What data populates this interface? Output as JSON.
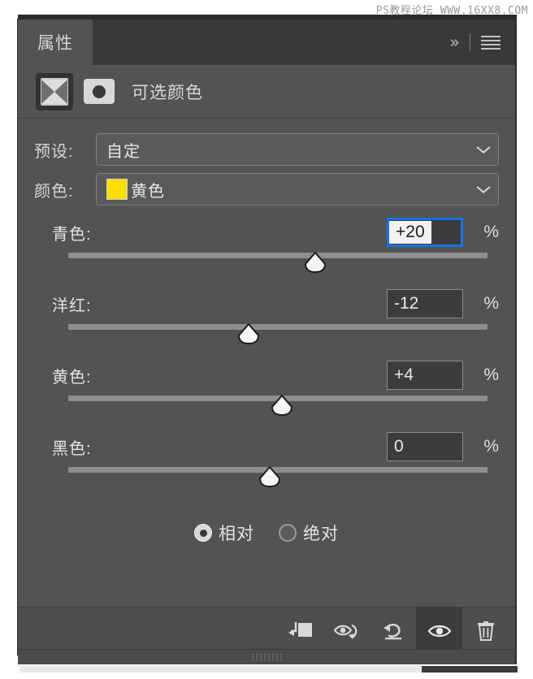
{
  "watermark": "PS教程论坛 WWW.16XX8.COM",
  "panel": {
    "tab_label": "属性",
    "collapse_icon": "chevron-double-right-icon",
    "menu_icon": "hamburger-menu-icon",
    "adjustment": {
      "title": "可选颜色",
      "thumbnail_icon": "selective-color-thumbnail-icon",
      "layer_mask_icon": "layer-mask-icon"
    }
  },
  "preset": {
    "label": "预设:",
    "value": "自定",
    "chevron_icon": "chevron-down-icon"
  },
  "color": {
    "label": "颜色:",
    "value": "黄色",
    "swatch_hex": "#FFDD00",
    "chevron_icon": "chevron-down-icon"
  },
  "sliders": [
    {
      "label": "青色:",
      "value": "+20",
      "unit": "%",
      "focused": true,
      "thumb_pct": 59
    },
    {
      "label": "洋红:",
      "value": "-12",
      "unit": "%",
      "focused": false,
      "thumb_pct": 43
    },
    {
      "label": "黄色:",
      "value": "+4",
      "unit": "%",
      "focused": false,
      "thumb_pct": 51
    },
    {
      "label": "黑色:",
      "value": "0",
      "unit": "%",
      "focused": false,
      "thumb_pct": 48
    }
  ],
  "method": {
    "relative": {
      "label": "相对",
      "selected": true
    },
    "absolute": {
      "label": "绝对",
      "selected": false
    }
  },
  "footer": {
    "clip_to_layer_icon": "clip-to-layer-icon",
    "view_previous_icon": "view-previous-state-icon",
    "reset_icon": "reset-icon",
    "visibility_icon": "toggle-visibility-eye-icon",
    "delete_icon": "trash-delete-icon"
  },
  "accent": {
    "focus_blue": "#1473E6",
    "panel_bg": "#535353",
    "header_bg": "#393939"
  }
}
